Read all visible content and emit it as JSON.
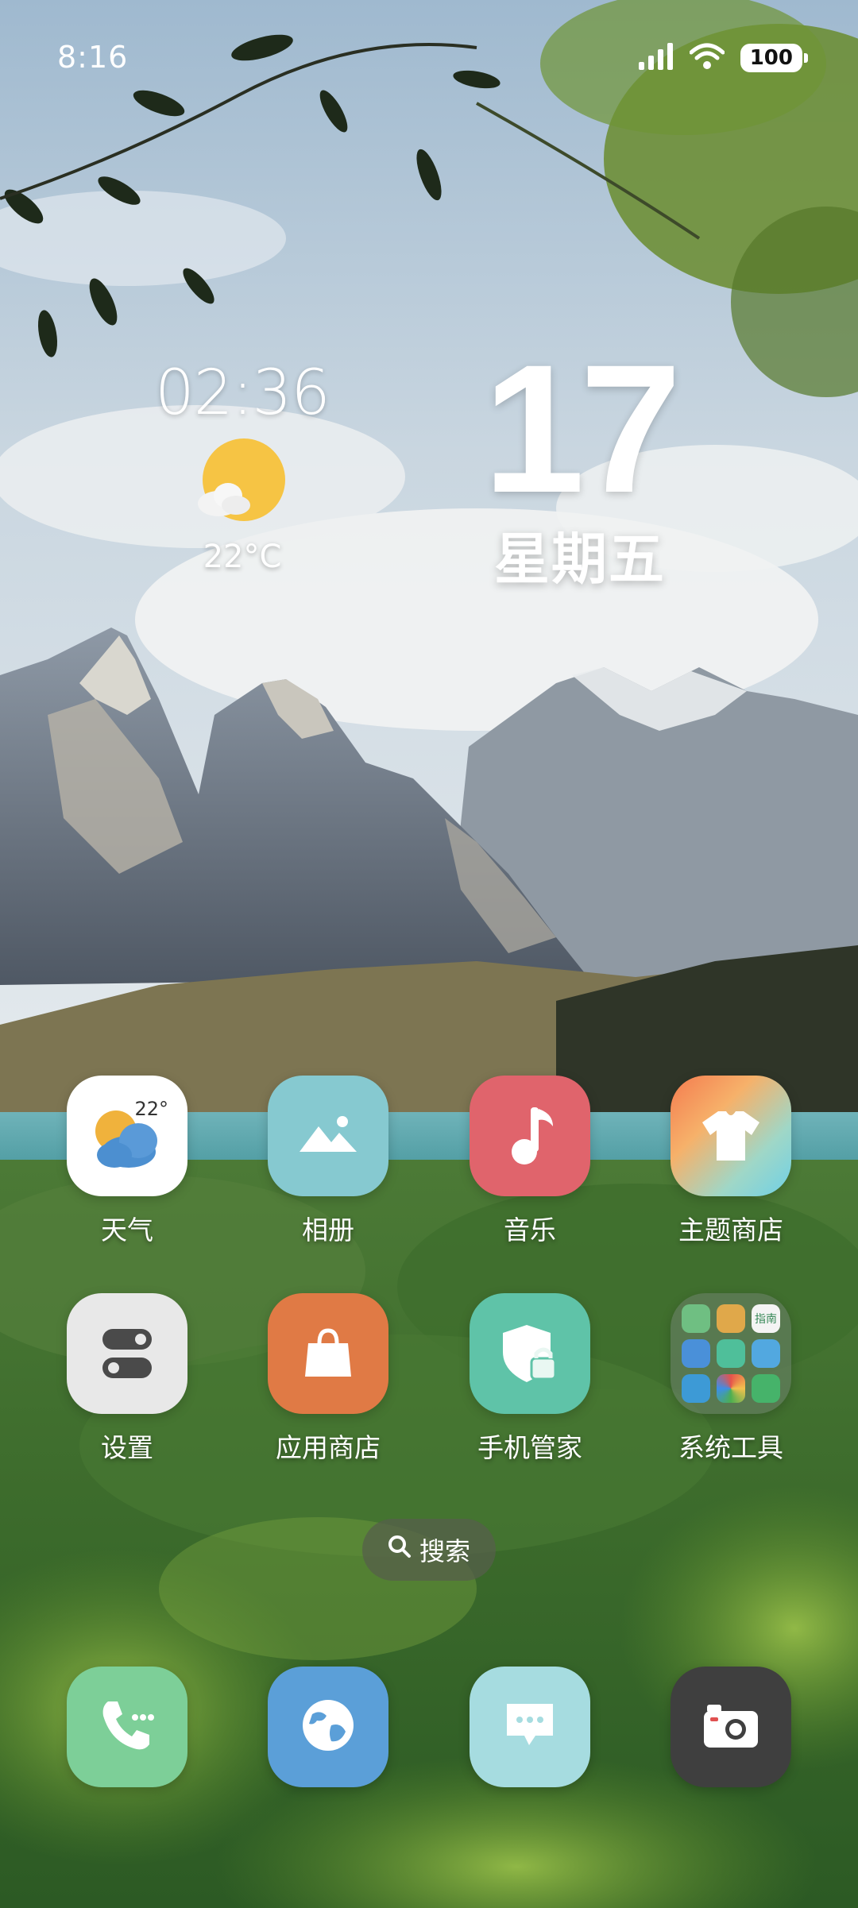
{
  "status_bar": {
    "time": "8:16",
    "battery": "100"
  },
  "clock_widget": {
    "time": "02:36",
    "temperature": "22°C",
    "weather_icon": "sunny-cloud-icon"
  },
  "date_widget": {
    "day": "17",
    "weekday": "星期五"
  },
  "apps": [
    {
      "label": "天气",
      "icon": "weather-icon",
      "badge": "22°",
      "color": "#ffffff"
    },
    {
      "label": "相册",
      "icon": "gallery-icon",
      "color": "#86c9d0"
    },
    {
      "label": "音乐",
      "icon": "music-note-icon",
      "color": "#e0646c"
    },
    {
      "label": "主题商店",
      "icon": "theme-shirt-icon",
      "color": "#f4a04f"
    },
    {
      "label": "设置",
      "icon": "settings-toggle-icon",
      "color": "#e8e8e8"
    },
    {
      "label": "应用商店",
      "icon": "shopping-bag-icon",
      "color": "#e07a45"
    },
    {
      "label": "手机管家",
      "icon": "shield-lock-icon",
      "color": "#5fc3a8"
    },
    {
      "label": "系统工具",
      "icon": "folder-icon",
      "color": "#6e826e"
    }
  ],
  "folder_mini_text": "指南",
  "search": {
    "label": "搜索"
  },
  "dock": [
    {
      "name": "phone",
      "icon": "phone-icon",
      "color": "#7dcf98"
    },
    {
      "name": "browser",
      "icon": "browser-globe-icon",
      "color": "#5b9fd8"
    },
    {
      "name": "messages",
      "icon": "message-icon",
      "color": "#a6dce0"
    },
    {
      "name": "camera",
      "icon": "camera-icon",
      "color": "#3f3f3f"
    }
  ]
}
